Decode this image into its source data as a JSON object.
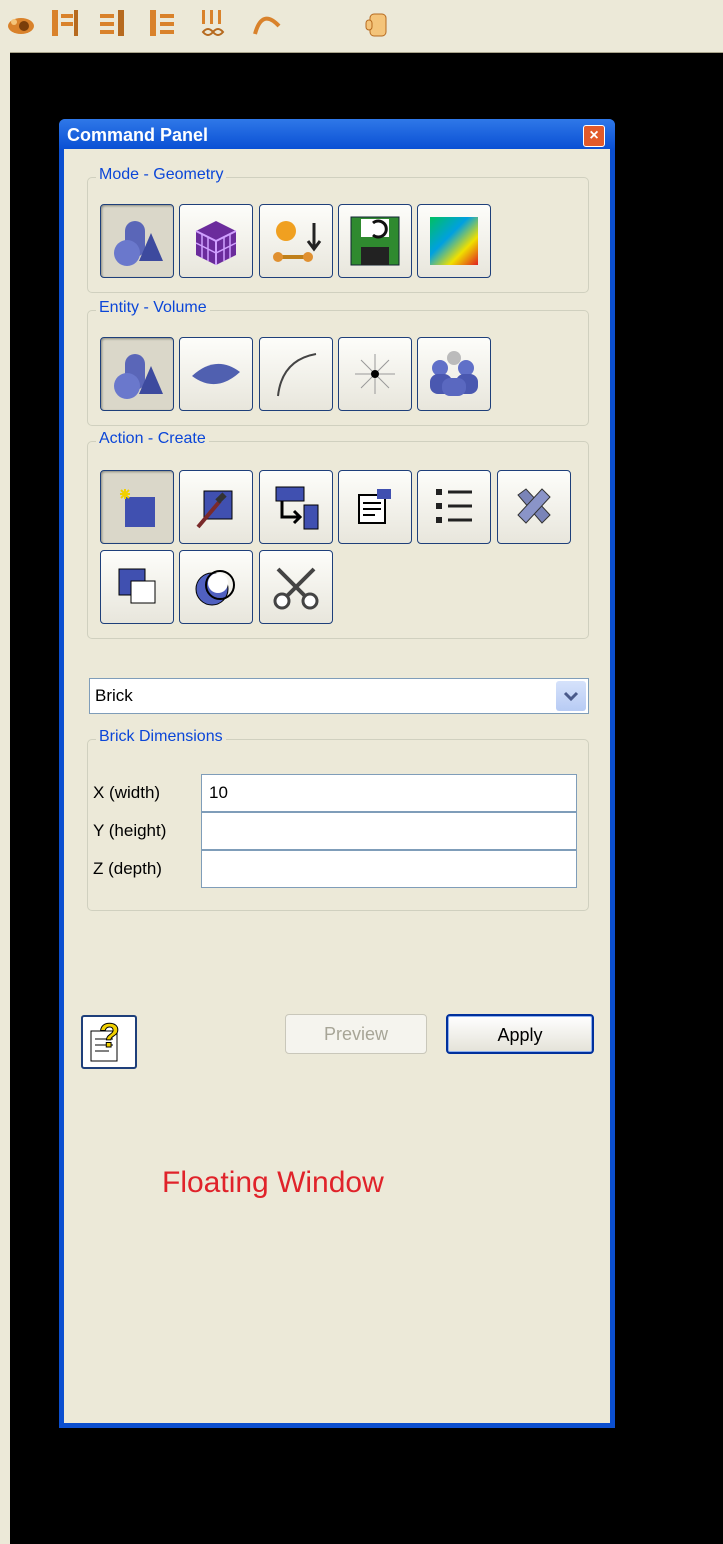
{
  "toolbar": {
    "icons": [
      "eye-icon",
      "panel-left-icon",
      "panel-right-icon",
      "panel-split-icon",
      "grid-infinity-icon",
      "curve-icon",
      "hand-icon"
    ]
  },
  "window": {
    "title": "Command Panel"
  },
  "mode": {
    "legend": "Mode - Geometry",
    "buttons": [
      "geometry-mode",
      "mesh-mode",
      "boundary-conditions-mode",
      "export-mode",
      "analysis-mode"
    ],
    "selected": "geometry-mode"
  },
  "entity": {
    "legend": "Entity - Volume",
    "buttons": [
      "volume",
      "surface",
      "curve",
      "vertex",
      "group"
    ],
    "selected": "volume"
  },
  "action": {
    "legend": "Action - Create",
    "buttons": [
      "create",
      "modify",
      "transform",
      "properties",
      "list",
      "delete",
      "imprint",
      "merge",
      "decompose"
    ],
    "selected": "create"
  },
  "shape_select": {
    "value": "Brick"
  },
  "dimensions": {
    "legend": "Brick Dimensions",
    "x_label": "X (width)",
    "x_value": "10",
    "y_label": "Y (height)",
    "y_value": "",
    "z_label": "Z (depth)",
    "z_value": ""
  },
  "buttons": {
    "preview": "Preview",
    "apply": "Apply"
  },
  "annotation": {
    "text": "Floating Window",
    "color": "#e0232a"
  },
  "colors": {
    "title_bar": "#0a50d4",
    "panel_bg": "#ece9d8",
    "legend_text": "#0b46d8"
  }
}
